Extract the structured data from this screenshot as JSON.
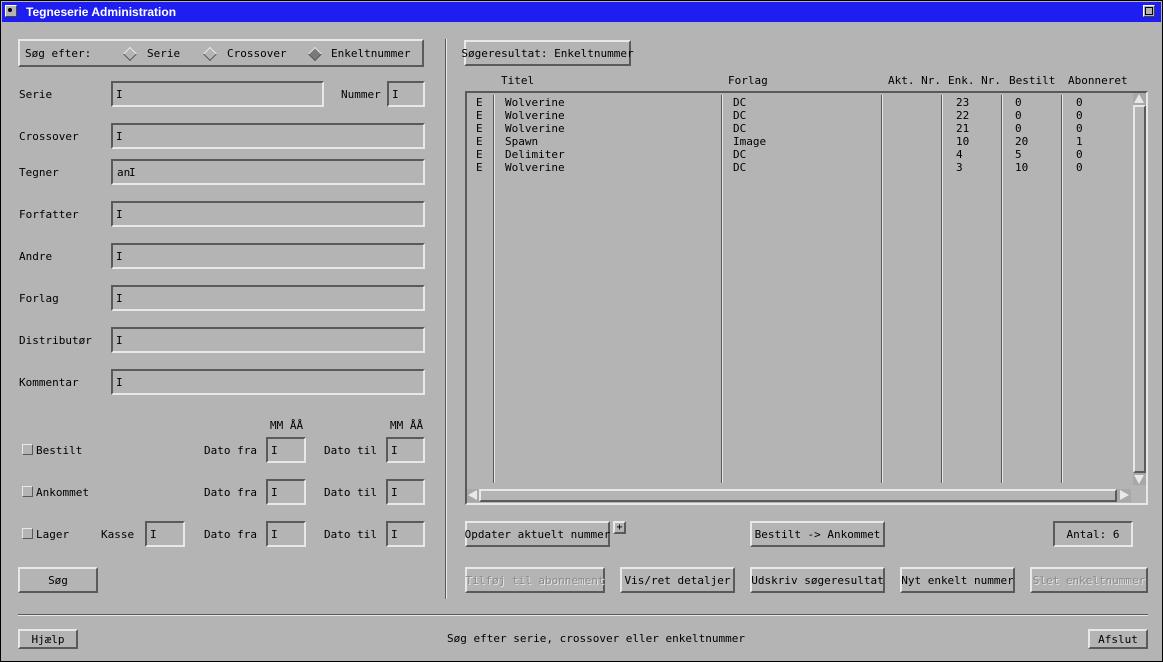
{
  "window": {
    "title": "Tegneserie Administration"
  },
  "search": {
    "label": "Søg efter:",
    "options": [
      "Serie",
      "Crossover",
      "Enkeltnummer"
    ],
    "selected": "Enkeltnummer"
  },
  "fields": {
    "serie": {
      "label": "Serie",
      "value": ""
    },
    "nummer": {
      "label": "Nummer",
      "value": ""
    },
    "crossover": {
      "label": "Crossover",
      "value": ""
    },
    "tegner": {
      "label": "Tegner",
      "value": "an"
    },
    "forfatter": {
      "label": "Forfatter",
      "value": ""
    },
    "andre": {
      "label": "Andre",
      "value": ""
    },
    "forlag": {
      "label": "Forlag",
      "value": ""
    },
    "distributor": {
      "label": "Distributør",
      "value": ""
    },
    "kommentar": {
      "label": "Kommentar",
      "value": ""
    }
  },
  "dates": {
    "mmaa": "MM ÅÅ",
    "dato_fra": "Dato fra",
    "dato_til": "Dato til",
    "kasse": "Kasse",
    "bestilt": "Bestilt",
    "ankommet": "Ankommet",
    "lager": "Lager"
  },
  "buttons": {
    "sog": "Søg",
    "hjaelp": "Hjælp",
    "afslut": "Afslut",
    "opdater": "Opdater aktuelt nummer",
    "plus": "+",
    "bestilt_ankommet": "Bestilt -> Ankommet",
    "antal": "Antal: 6",
    "tilfoej": "Tilføj til abonnement",
    "vis_ret": "Vis/ret detaljer",
    "udskriv": "Udskriv søgeresultat",
    "nyt": "Nyt enkelt nummer",
    "slet": "Slet enkeltnummer"
  },
  "results": {
    "title": "Søgeresultat: Enkeltnummer",
    "columns": [
      "Titel",
      "Forlag",
      "Akt. Nr.",
      "Enk. Nr.",
      "Bestilt",
      "Abonneret"
    ],
    "rows": [
      [
        "E",
        "Wolverine",
        "DC",
        "",
        "23",
        "0",
        "0"
      ],
      [
        "E",
        "Wolverine",
        "DC",
        "",
        "22",
        "0",
        "0"
      ],
      [
        "E",
        "Wolverine",
        "DC",
        "",
        "21",
        "0",
        "0"
      ],
      [
        "E",
        "Spawn",
        "Image",
        "",
        "10",
        "20",
        "1"
      ],
      [
        "E",
        "Delimiter",
        "DC",
        "",
        "4",
        "5",
        "0"
      ],
      [
        "E",
        "Wolverine",
        "DC",
        "",
        "3",
        "10",
        "0"
      ]
    ]
  },
  "status": "Søg efter serie, crossover eller enkeltnummer"
}
